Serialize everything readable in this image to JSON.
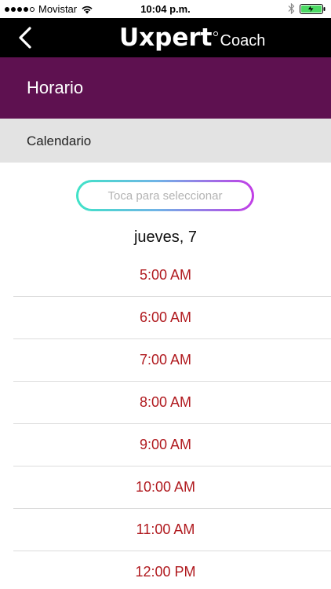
{
  "status_bar": {
    "carrier": "Movistar",
    "time": "10:04 p.m.",
    "signal_bars_filled": 4,
    "signal_bars_total": 5,
    "battery_level": 1.0
  },
  "header": {
    "logo_text": "Uxpert",
    "logo_sub": "Coach",
    "back_icon": "chevron-left-icon"
  },
  "title_band": {
    "title": "Horario"
  },
  "section": {
    "label": "Calendario"
  },
  "selector": {
    "placeholder": "Toca para seleccionar"
  },
  "date": "jueves, 7",
  "times": [
    "5:00 AM",
    "6:00 AM",
    "7:00 AM",
    "8:00 AM",
    "9:00 AM",
    "10:00 AM",
    "11:00 AM",
    "12:00 PM"
  ],
  "colors": {
    "header_bg": "#000000",
    "title_band_bg": "#5e1150",
    "section_bg": "#e3e3e3",
    "time_text": "#b0191e",
    "selector_gradient_start": "#3fe3c7",
    "selector_gradient_end": "#c23de6"
  }
}
